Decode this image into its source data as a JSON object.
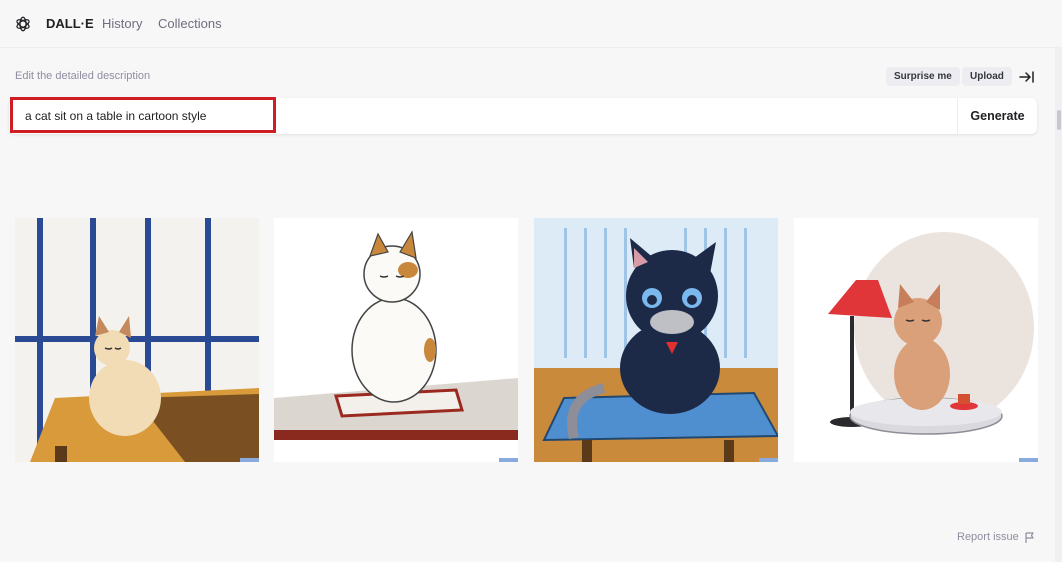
{
  "nav": {
    "brand": "DALL·E",
    "links": [
      "History",
      "Collections"
    ]
  },
  "editor": {
    "label": "Edit the detailed description",
    "prompt": "a cat sit on a table in cartoon style",
    "generate_label": "Generate",
    "surprise_label": "Surprise me",
    "upload_label": "Upload"
  },
  "results": {
    "images": [
      {
        "icon": "cat-on-wooden-table-image"
      },
      {
        "icon": "cat-on-white-tray-image"
      },
      {
        "icon": "dark-cat-on-blue-mat-image"
      },
      {
        "icon": "cat-beside-red-lamp-image"
      }
    ]
  },
  "footer": {
    "report_label": "Report issue"
  },
  "colors": {
    "accent": "#d01c25",
    "background": "#f7f7f8",
    "text_muted": "#8e8ea0"
  }
}
